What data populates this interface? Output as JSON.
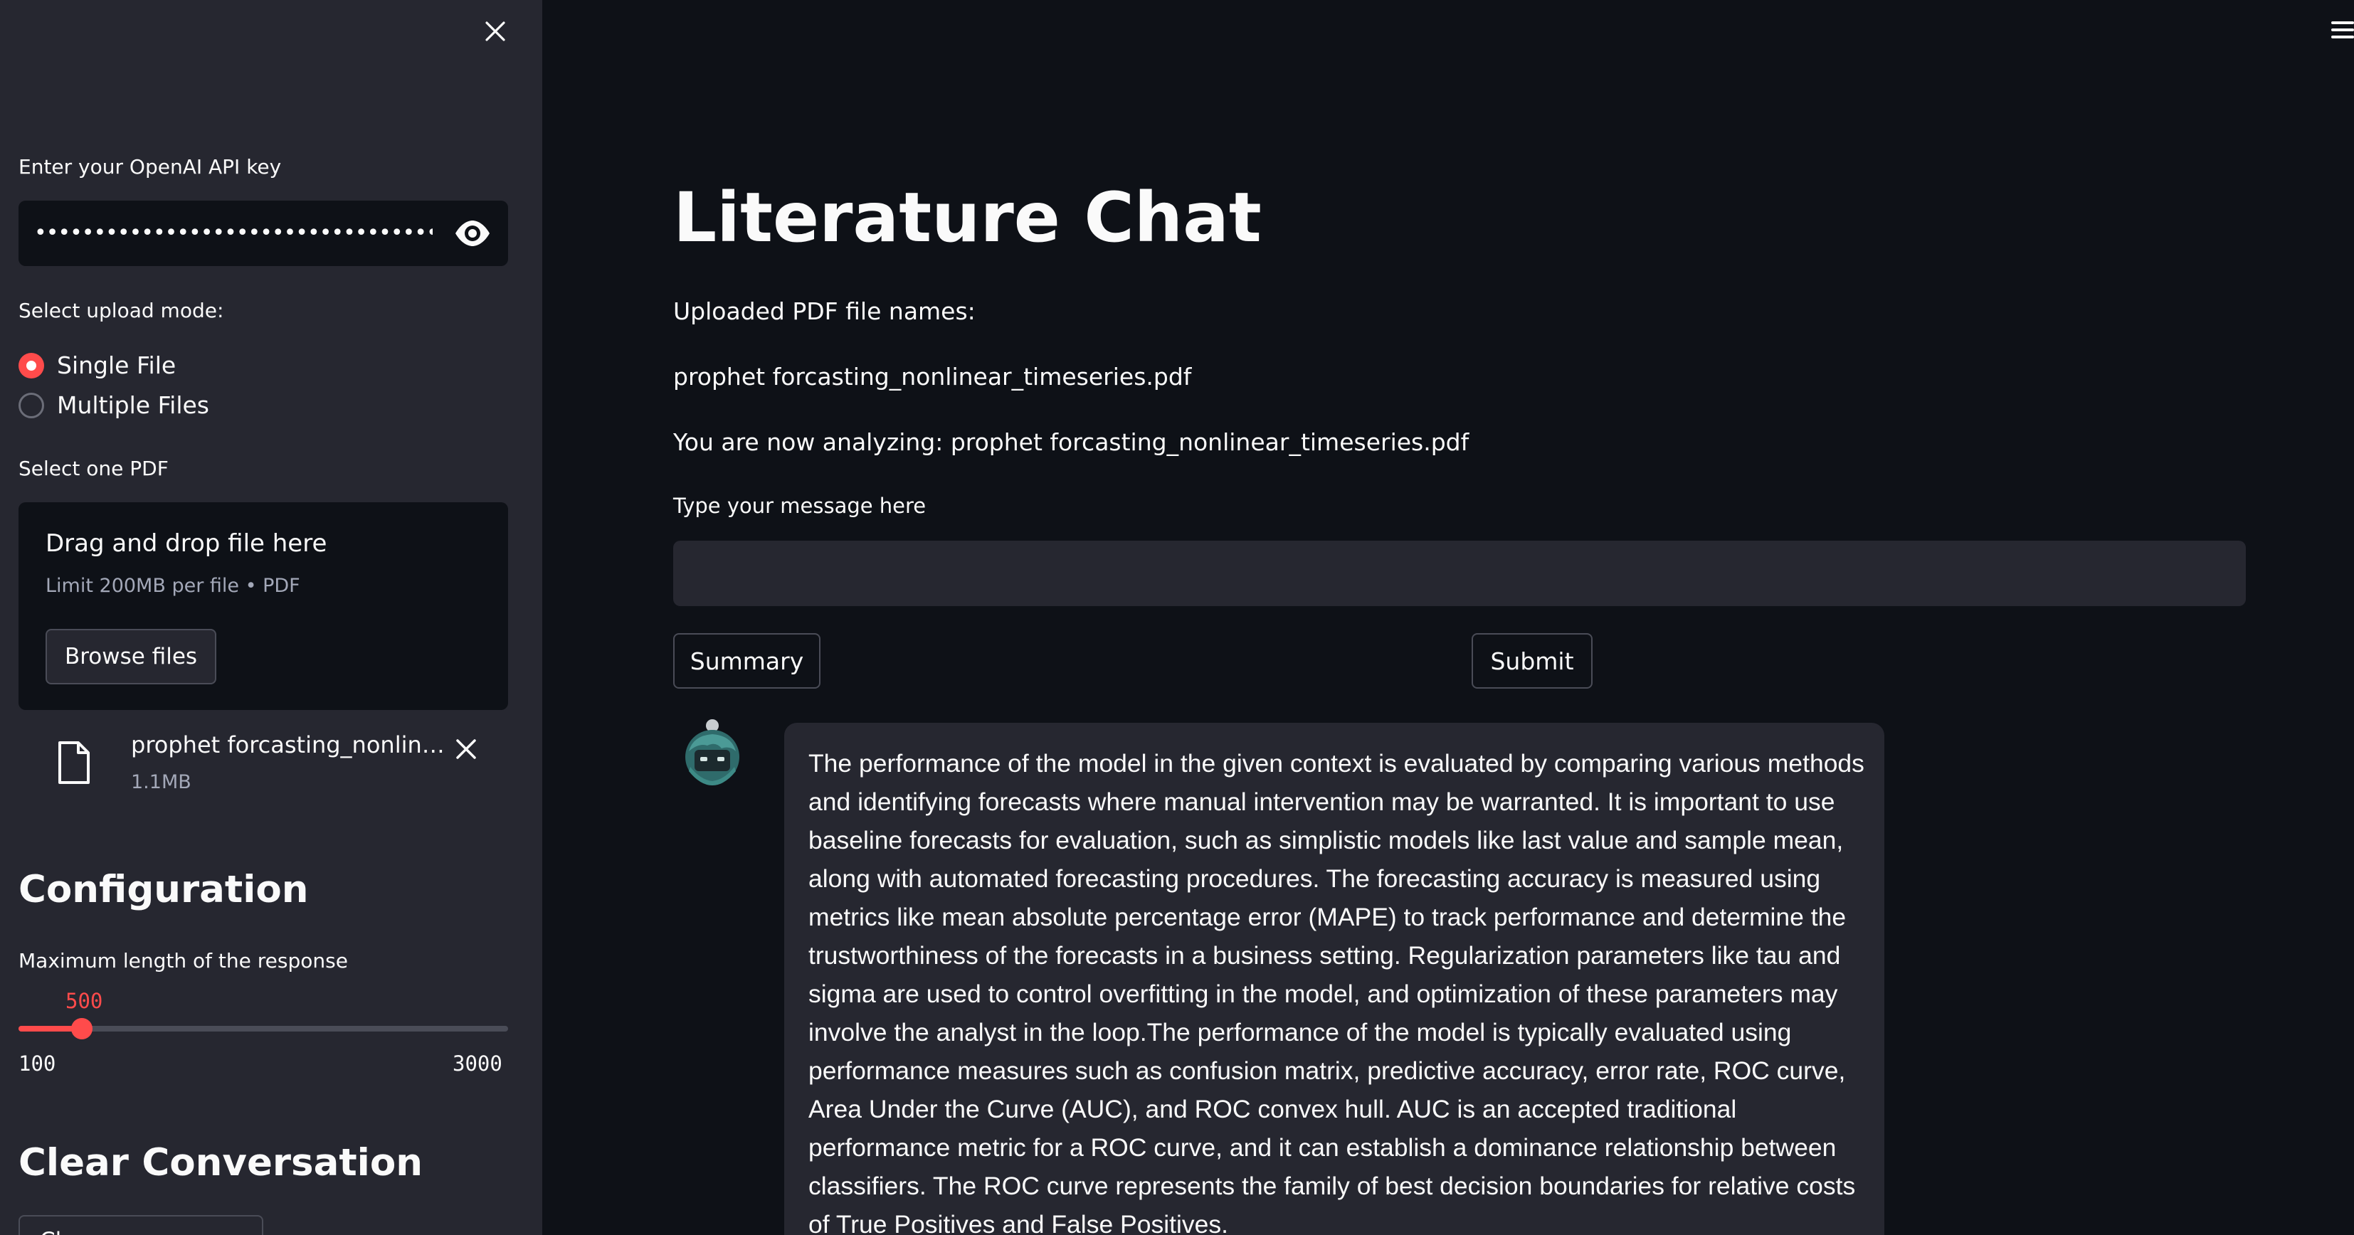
{
  "sidebar": {
    "api_key_label": "Enter your OpenAI API key",
    "api_key_value": "••••••••••••••••••••••••••••••••••••••••••••••••••••••••",
    "upload_mode_label": "Select upload mode:",
    "upload_modes": [
      {
        "label": "Single File",
        "selected": true
      },
      {
        "label": "Multiple Files",
        "selected": false
      }
    ],
    "select_pdf_label": "Select one PDF",
    "dropzone": {
      "title": "Drag and drop file here",
      "limit": "Limit 200MB per file • PDF",
      "browse_label": "Browse files"
    },
    "uploaded_file": {
      "name": "prophet forcasting_nonlinear_timeseries.pdf",
      "size": "1.1MB"
    },
    "configuration_heading": "Configuration",
    "max_length_label": "Maximum length of the response",
    "slider": {
      "value": "500",
      "min": "100",
      "max": "3000",
      "numeric_value": 500,
      "numeric_min": 100,
      "numeric_max": 3000
    },
    "clear_heading": "Clear Conversation",
    "clear_button_label": "Clear Conversation"
  },
  "main": {
    "title": "Literature Chat",
    "uploaded_names_label": "Uploaded PDF file names:",
    "uploaded_file_name": "prophet forcasting_nonlinear_timeseries.pdf",
    "analyzing_text": "You are now analyzing: prophet forcasting_nonlinear_timeseries.pdf",
    "message_label": "Type your message here",
    "message_value": "",
    "summary_label": "Summary",
    "submit_label": "Submit",
    "response": "The performance of the model in the given context is evaluated by comparing various methods and identifying forecasts where manual intervention may be warranted. It is important to use baseline forecasts for evaluation, such as simplistic models like last value and sample mean, along with automated forecasting procedures. The forecasting accuracy is measured using metrics like mean absolute percentage error (MAPE) to track performance and determine the trustworthiness of the forecasts in a business setting. Regularization parameters like tau and sigma are used to control overfitting in the model, and optimization of these parameters may involve the analyst in the loop.The performance of the model is typically evaluated using performance measures such as confusion matrix, predictive accuracy, error rate, ROC curve, Area Under the Curve (AUC), and ROC convex hull. AUC is an accepted traditional performance metric for a ROC curve, and it can establish a dominance relationship between classifiers. The ROC curve represents the family of best decision boundaries for relative costs of True Positives and False Positives."
  },
  "colors": {
    "background": "#0e1117",
    "sidebar": "#262730",
    "accent": "#ff4b4b",
    "text": "#fafafa",
    "muted": "#a3a8b8"
  },
  "icons": {
    "close": "close-icon",
    "eye": "eye-icon",
    "file": "file-icon",
    "remove": "close-icon",
    "menu": "hamburger-menu-icon",
    "avatar": "robot-avatar-icon"
  }
}
